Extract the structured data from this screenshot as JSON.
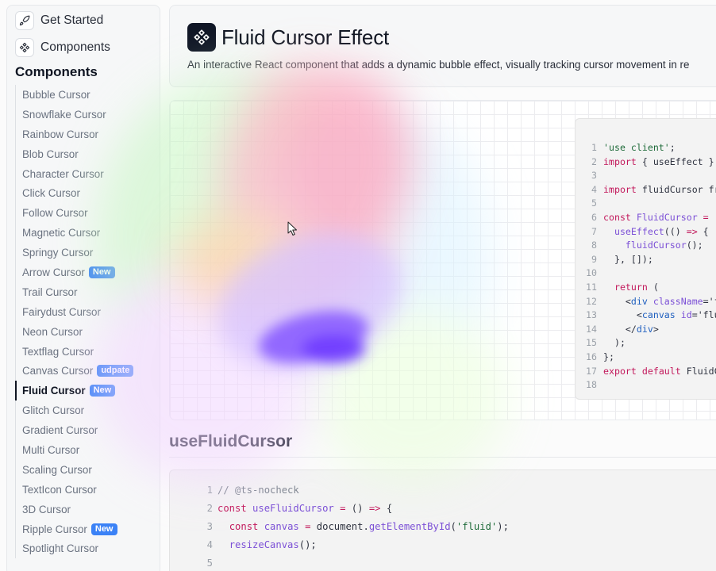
{
  "sidebar": {
    "top_links": [
      {
        "label": "Get Started",
        "icon": "rocket-icon"
      },
      {
        "label": "Components",
        "icon": "components-icon"
      }
    ],
    "section_title": "Components",
    "items": [
      {
        "label": "Bubble Cursor"
      },
      {
        "label": "Snowflake Cursor"
      },
      {
        "label": "Rainbow Cursor"
      },
      {
        "label": "Blob Cursor"
      },
      {
        "label": "Character Cursor"
      },
      {
        "label": "Click Cursor"
      },
      {
        "label": "Follow Cursor"
      },
      {
        "label": "Magnetic Cursor"
      },
      {
        "label": "Springy Cursor"
      },
      {
        "label": "Arrow Cursor",
        "badge": "New"
      },
      {
        "label": "Trail Cursor"
      },
      {
        "label": "Fairydust Cursor"
      },
      {
        "label": "Neon Cursor"
      },
      {
        "label": "Textflag Cursor"
      },
      {
        "label": "Canvas Cursor",
        "badge": "udpate"
      },
      {
        "label": "Fluid Cursor",
        "badge": "New",
        "active": true
      },
      {
        "label": "Glitch Cursor"
      },
      {
        "label": "Gradient Cursor"
      },
      {
        "label": "Multi Cursor"
      },
      {
        "label": "Scaling Cursor"
      },
      {
        "label": "TextIcon Cursor"
      },
      {
        "label": "3D Cursor"
      },
      {
        "label": "Ripple Cursor",
        "badge": "New"
      },
      {
        "label": "Spotlight Cursor"
      }
    ]
  },
  "header": {
    "logo_icon": "components-icon",
    "title": "Fluid Cursor Effect",
    "description": "An interactive React component that adds a dynamic bubble effect, visually tracking cursor movement in re"
  },
  "preview_code": [
    {
      "n": "1",
      "tokens": [
        [
          "str",
          "'use client'"
        ],
        [
          "",
          ";"
        ]
      ]
    },
    {
      "n": "2",
      "tokens": [
        [
          "kw",
          "import"
        ],
        [
          "",
          " { useEffect }"
        ]
      ]
    },
    {
      "n": "3",
      "tokens": []
    },
    {
      "n": "4",
      "tokens": [
        [
          "kw",
          "import"
        ],
        [
          "",
          " fluidCursor fr"
        ]
      ]
    },
    {
      "n": "5",
      "tokens": []
    },
    {
      "n": "6",
      "tokens": [
        [
          "kw",
          "const"
        ],
        [
          "",
          " "
        ],
        [
          "fn",
          "FluidCursor"
        ],
        [
          "",
          " "
        ],
        [
          "kw",
          "="
        ],
        [
          "",
          " ("
        ]
      ]
    },
    {
      "n": "7",
      "tokens": [
        [
          "",
          "  "
        ],
        [
          "fn",
          "useEffect"
        ],
        [
          "",
          "(() "
        ],
        [
          "kw",
          "=>"
        ],
        [
          "",
          " {"
        ]
      ]
    },
    {
      "n": "8",
      "tokens": [
        [
          "",
          "    "
        ],
        [
          "fn",
          "fluidCursor"
        ],
        [
          "",
          "();"
        ]
      ]
    },
    {
      "n": "9",
      "tokens": [
        [
          "",
          "  }, []);"
        ]
      ]
    },
    {
      "n": "10",
      "tokens": []
    },
    {
      "n": "11",
      "tokens": [
        [
          "",
          "  "
        ],
        [
          "kw",
          "return"
        ],
        [
          "",
          " ("
        ]
      ]
    },
    {
      "n": "12",
      "tokens": [
        [
          "",
          "    <"
        ],
        [
          "prop",
          "div"
        ],
        [
          "",
          " "
        ],
        [
          "fn",
          "className"
        ],
        [
          "",
          "='f"
        ]
      ]
    },
    {
      "n": "13",
      "tokens": [
        [
          "",
          "      <"
        ],
        [
          "prop",
          "canvas"
        ],
        [
          "",
          " "
        ],
        [
          "fn",
          "id"
        ],
        [
          "",
          "='flu"
        ]
      ]
    },
    {
      "n": "14",
      "tokens": [
        [
          "",
          "    </"
        ],
        [
          "prop",
          "div"
        ],
        [
          "",
          ">"
        ]
      ]
    },
    {
      "n": "15",
      "tokens": [
        [
          "",
          "  );"
        ]
      ]
    },
    {
      "n": "16",
      "tokens": [
        [
          "",
          "};"
        ]
      ]
    },
    {
      "n": "17",
      "tokens": [
        [
          "kw",
          "export"
        ],
        [
          "",
          " "
        ],
        [
          "kw",
          "default"
        ],
        [
          "",
          " FluidC"
        ]
      ]
    },
    {
      "n": "18",
      "tokens": []
    }
  ],
  "section_heading": "useFluidCursor",
  "hook_code": [
    {
      "n": "1",
      "tokens": [
        [
          "cm",
          "// @ts-nocheck"
        ]
      ]
    },
    {
      "n": "2",
      "tokens": [
        [
          "kw",
          "const"
        ],
        [
          "",
          " "
        ],
        [
          "fn",
          "useFluidCursor"
        ],
        [
          "",
          " "
        ],
        [
          "kw",
          "="
        ],
        [
          "",
          " () "
        ],
        [
          "kw",
          "=>"
        ],
        [
          "",
          " {"
        ]
      ]
    },
    {
      "n": "3",
      "tokens": [
        [
          "",
          "  "
        ],
        [
          "kw",
          "const"
        ],
        [
          "",
          " "
        ],
        [
          "fn",
          "canvas"
        ],
        [
          "",
          " "
        ],
        [
          "kw",
          "="
        ],
        [
          "",
          " document."
        ],
        [
          "fn",
          "getElementById"
        ],
        [
          "",
          "("
        ],
        [
          "str",
          "'fluid'"
        ],
        [
          "",
          ");"
        ]
      ]
    },
    {
      "n": "4",
      "tokens": [
        [
          "",
          "  "
        ],
        [
          "fn",
          "resizeCanvas"
        ],
        [
          "",
          "();"
        ]
      ]
    },
    {
      "n": "5",
      "tokens": []
    }
  ],
  "colors": {
    "accent_badge": "#3b82f6",
    "logo_bg": "#101626"
  }
}
